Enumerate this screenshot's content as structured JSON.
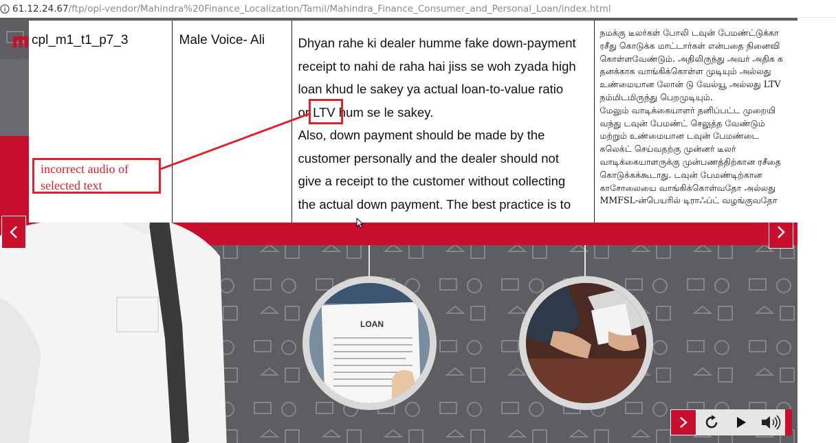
{
  "browser": {
    "url_host": "61.12.24.67",
    "url_path": "/ftp/opi-vendor/Mahindra%20Finance_Localization/Tamil/Mahindra_Finance_Consumer_and_Personal_Loan/index.html"
  },
  "review_row": {
    "screen_id": "cpl_m1_t1_p7_3",
    "voice": "Male Voice- Ali",
    "script_lines": [
      "Dhyan rahe ki dealer humme fake down-payment",
      "receipt to nahi de raha hai jiss se woh zyada high",
      "loan khud le sakey ya actual loan-to-value ratio",
      "or LTV hum se le sakey.",
      "Also, down payment should be made by the",
      "customer personally and the dealer should not",
      "give a receipt to the customer without collecting",
      "the actual down payment. The best practice is to"
    ],
    "tamil_lines": [
      "நமக்கு டீலர்கள் போலி டவுன் பேமண்ட்டுக்கா",
      "ரசீது கொடுக்க மாட்டார்கள் என்பதை நினைவி",
      "கொள்ளவேண்டும். அதிலிருந்து அவர் அதிக க",
      "தனக்காக வாங்கிக்கொள்ள முடியும் அல்லது",
      "உண்மையான லோன் டு வேல்யூ அல்லது LTV",
      "நம்மிடமிருந்து பெறமுடியும்.",
      "மேலும் வாடிக்கையாளர் தனிப்பட்ட முறையி",
      "வந்து டவுன் பேமண்ட் செலுத்த வேண்டும்",
      "மற்றும் உண்மையான டவுன் பேமண்டை",
      "கலெக்ட் செய்வதற்கு முன்னர் டீலர்",
      "வாடிக்கையாளருக்கு முன்பணத்திற்கான ரசீதை",
      "கொடுக்கக்கூடாது. டவுன் பேமண்டிற்கான",
      "காசோலையை வாங்கிக்கொள்வதோ அல்லது",
      "MMFSL-ன்பெயரில் டிராஃப்ட் வழங்குவதோ"
    ]
  },
  "annotation": {
    "callout_text_line1": "incorrect audio of",
    "callout_text_line2": "selected text",
    "highlighted_word": "LTV"
  },
  "course": {
    "loan_doc_label": "LOAN",
    "brand_color": "#c8102e",
    "icons": [
      "prev-arrow-icon",
      "next-arrow-icon",
      "replay-icon",
      "play-icon",
      "volume-icon",
      "next-red-icon"
    ]
  }
}
